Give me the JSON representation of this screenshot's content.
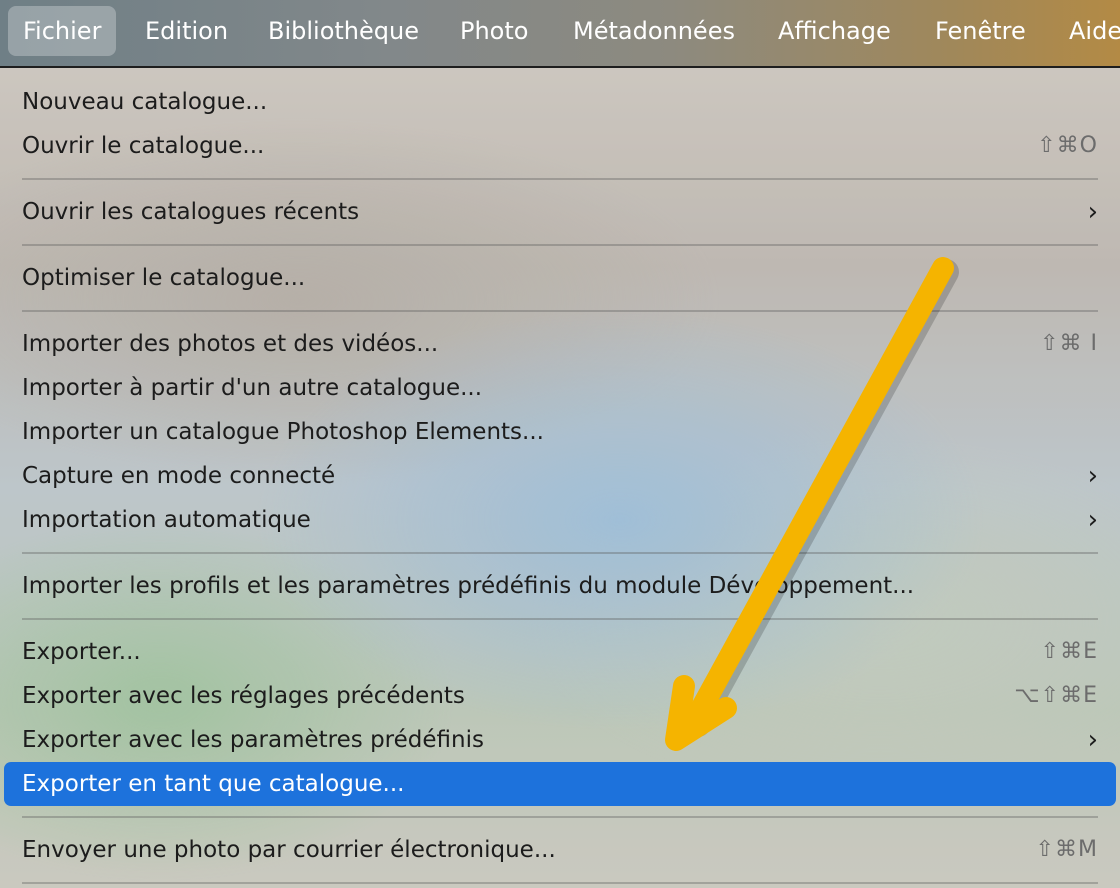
{
  "menubar": {
    "items": [
      {
        "label": "Fichier",
        "active": true
      },
      {
        "label": "Edition"
      },
      {
        "label": "Bibliothèque"
      },
      {
        "label": "Photo"
      },
      {
        "label": "Métadonnées"
      },
      {
        "label": "Affichage"
      },
      {
        "label": "Fenêtre"
      },
      {
        "label": "Aide"
      }
    ]
  },
  "menu": {
    "items": [
      {
        "label": "Nouveau catalogue..."
      },
      {
        "label": "Ouvrir le catalogue...",
        "shortcut": "⇧⌘O"
      },
      {
        "label": "Ouvrir les catalogues récents",
        "submenu": "›"
      },
      {
        "label": "Optimiser le catalogue..."
      },
      {
        "label": "Importer des photos et des vidéos...",
        "shortcut": "⇧⌘ I"
      },
      {
        "label": "Importer à partir d'un autre catalogue..."
      },
      {
        "label": "Importer un catalogue Photoshop Elements..."
      },
      {
        "label": "Capture en mode connecté",
        "submenu": "›"
      },
      {
        "label": "Importation automatique",
        "submenu": "›"
      },
      {
        "label": "Importer les profils et les paramètres prédéfinis du module Développement..."
      },
      {
        "label": "Exporter...",
        "shortcut": "⇧⌘E"
      },
      {
        "label": "Exporter avec les réglages précédents",
        "shortcut": "⌥⇧⌘E"
      },
      {
        "label": "Exporter avec les paramètres prédéfinis",
        "submenu": "›"
      },
      {
        "label": "Exporter en tant que catalogue...",
        "selected": true
      },
      {
        "label": "Envoyer une photo par courrier électronique...",
        "shortcut": "⇧⌘M"
      }
    ]
  },
  "annotation": {
    "arrow_color": "#f5b400",
    "arrow_icon": "arrow-pointer-icon"
  }
}
